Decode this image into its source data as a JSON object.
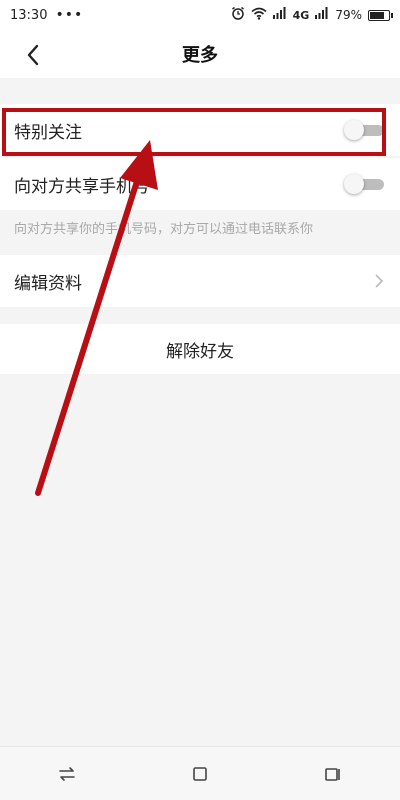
{
  "status_bar": {
    "time": "13:30",
    "dots": "•••",
    "network": "4G",
    "battery_text": "79%",
    "battery_level": 0.79,
    "icons": [
      "alarm-icon",
      "wifi-icon",
      "signal-icon",
      "signal-icon",
      "battery-icon"
    ]
  },
  "header": {
    "title": "更多",
    "back_icon": "back-chevron-icon"
  },
  "settings": {
    "special_follow": {
      "label": "特别关注",
      "on": false
    },
    "share_phone": {
      "label": "向对方共享手机号",
      "on": false
    },
    "share_phone_hint": "向对方共享你的手机号码，对方可以通过电话联系你",
    "edit_profile": {
      "label": "编辑资料"
    },
    "unfriend": {
      "label": "解除好友"
    }
  },
  "annotation": {
    "color": "#b80f15"
  },
  "system_nav": {
    "icons": [
      "switch-arrows-icon",
      "home-square-icon",
      "recent-icon"
    ]
  },
  "colors": {
    "background": "#f4f4f4",
    "card": "#ffffff",
    "toggle_off": "#bdbdbd",
    "hint_text": "#a8a8a8"
  }
}
